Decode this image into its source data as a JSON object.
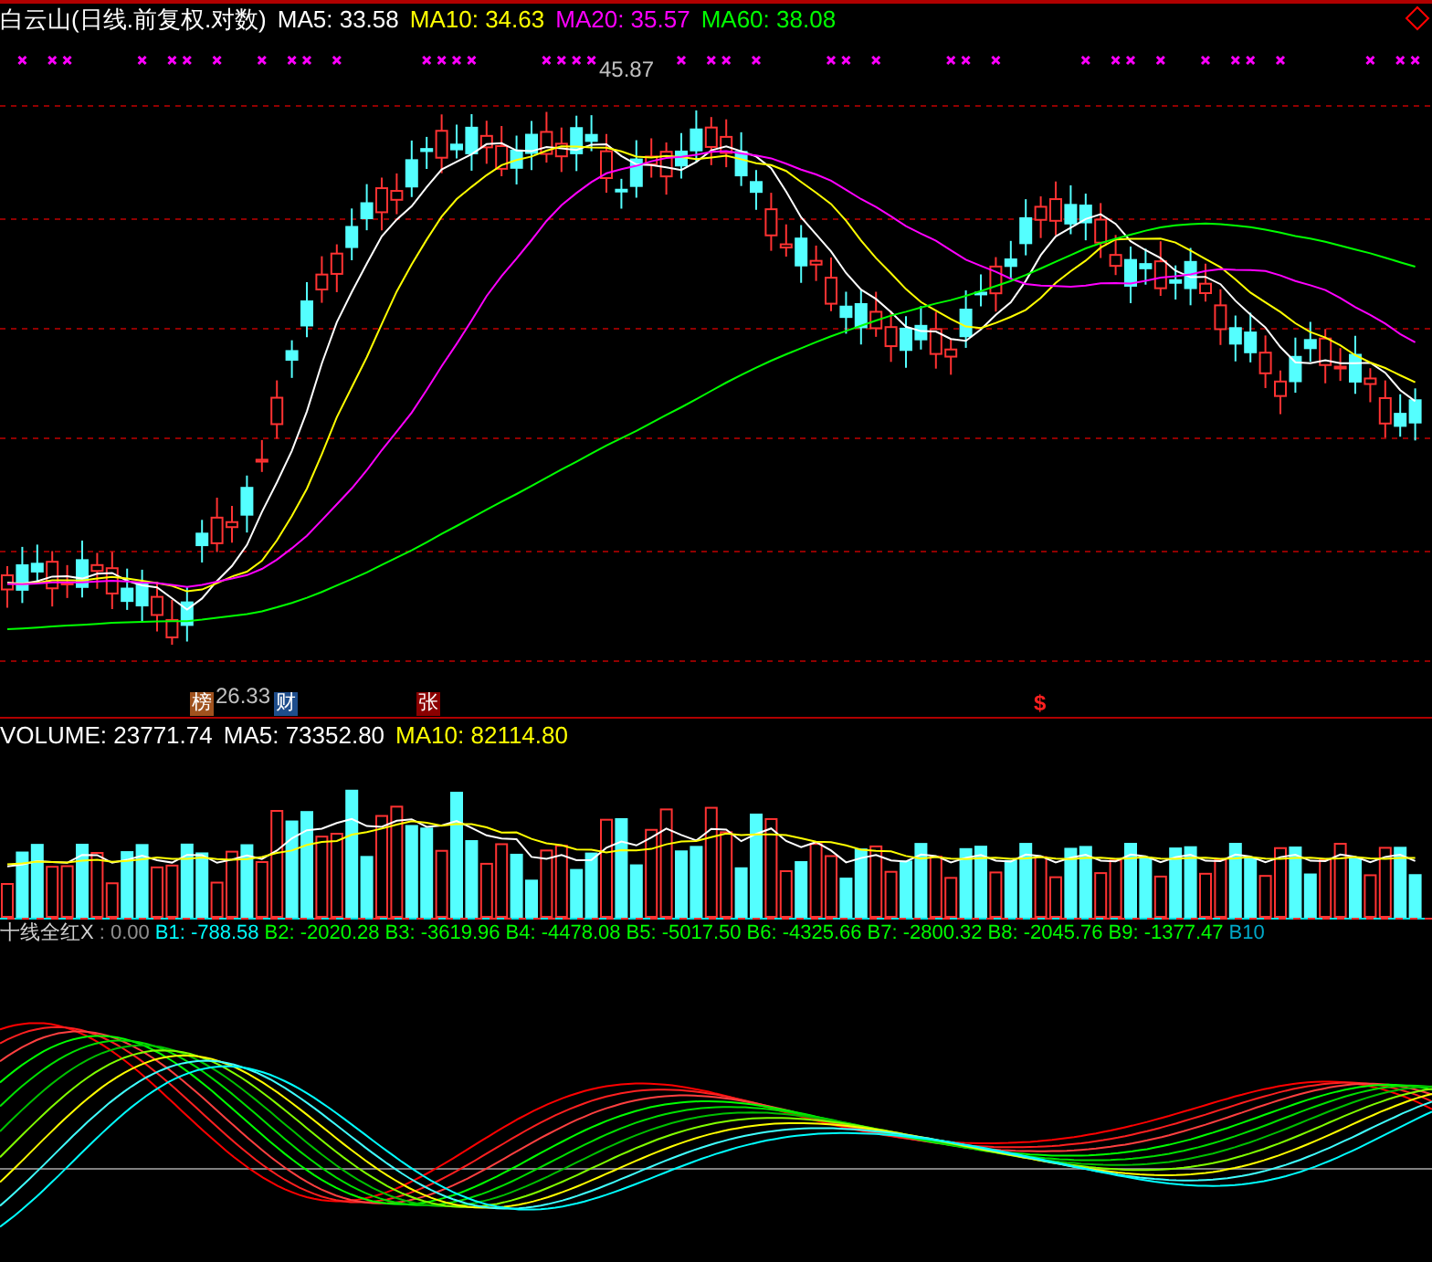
{
  "header": {
    "title": "白云山(日线.前复权.对数)",
    "indicators": [
      {
        "label": "MA5: 33.58",
        "color": "#ffffff"
      },
      {
        "label": "MA10: 34.63",
        "color": "#ffff00"
      },
      {
        "label": "MA20: 35.57",
        "color": "#ff00ff"
      },
      {
        "label": "MA60: 38.08",
        "color": "#00ff00"
      }
    ]
  },
  "price_chart": {
    "high_label": "45.87",
    "low_label": "26.33",
    "event_markers": [
      {
        "text": "榜",
        "color": "#a0521e"
      },
      {
        "text": "财",
        "color": "#1f4e8c"
      },
      {
        "text": "张",
        "color": "#8b0000"
      }
    ],
    "signal_marker": "$"
  },
  "volume": {
    "indicators": [
      {
        "label": "VOLUME: 23771.74",
        "color": "#ffffff"
      },
      {
        "label": "MA5: 73352.80",
        "color": "#ffffff"
      },
      {
        "label": "MA10: 82114.80",
        "color": "#ffff00"
      }
    ]
  },
  "oscillator": {
    "name": "十线全红X",
    "value": ": 0.00",
    "series": [
      {
        "label": "B1: -788.58",
        "color": "#00ffff"
      },
      {
        "label": "B2: -2020.28",
        "color": "#00ff00"
      },
      {
        "label": "B3: -3619.96",
        "color": "#00ff00"
      },
      {
        "label": "B4: -4478.08",
        "color": "#00ff00"
      },
      {
        "label": "B5: -5017.50",
        "color": "#00ff00"
      },
      {
        "label": "B6: -4325.66",
        "color": "#00ff00"
      },
      {
        "label": "B7: -2800.32",
        "color": "#00ff00"
      },
      {
        "label": "B8: -2045.76",
        "color": "#00ff00"
      },
      {
        "label": "B9: -1377.47",
        "color": "#00ff00"
      },
      {
        "label": "B10",
        "color": "#00a8c8"
      }
    ]
  }
}
